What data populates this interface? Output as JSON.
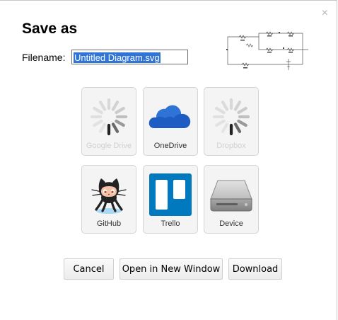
{
  "dialog": {
    "title": "Save as",
    "close_glyph": "×",
    "filename_label": "Filename:",
    "filename_value": "Untitled Diagram.svg"
  },
  "storage": [
    {
      "id": "google-drive",
      "label": "Google Drive",
      "icon": "spinner-icon",
      "enabled": false
    },
    {
      "id": "onedrive",
      "label": "OneDrive",
      "icon": "onedrive-cloud-icon",
      "enabled": true
    },
    {
      "id": "dropbox",
      "label": "Dropbox",
      "icon": "spinner-icon",
      "enabled": false
    },
    {
      "id": "github",
      "label": "GitHub",
      "icon": "github-octocat-icon",
      "enabled": true
    },
    {
      "id": "trello",
      "label": "Trello",
      "icon": "trello-icon",
      "enabled": true
    },
    {
      "id": "device",
      "label": "Device",
      "icon": "hard-drive-icon",
      "enabled": true
    }
  ],
  "buttons": {
    "cancel": "Cancel",
    "open_new_window": "Open in New Window",
    "download": "Download"
  },
  "colors": {
    "selection": "#3074d6",
    "onedrive_blue": "#1e5cc4",
    "trello_blue": "#0079bf"
  }
}
